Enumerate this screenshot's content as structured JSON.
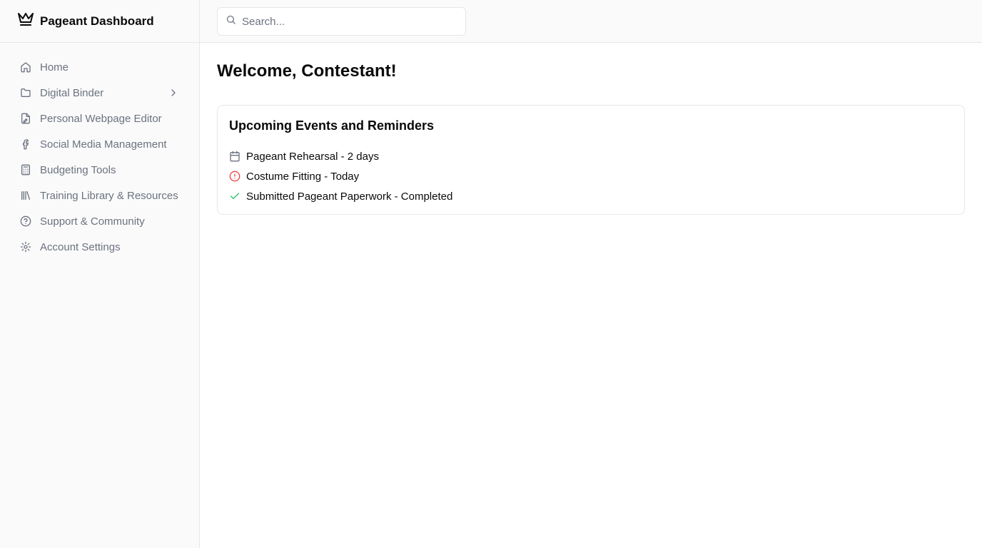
{
  "app": {
    "title": "Pageant Dashboard",
    "logo_icon": "crown-icon"
  },
  "sidebar": {
    "items": [
      {
        "label": "Home",
        "icon": "home-icon"
      },
      {
        "label": "Digital Binder",
        "icon": "folder-icon",
        "has_submenu": true
      },
      {
        "label": "Personal Webpage Editor",
        "icon": "file-edit-icon"
      },
      {
        "label": "Social Media Management",
        "icon": "facebook-icon"
      },
      {
        "label": "Budgeting Tools",
        "icon": "calculator-icon"
      },
      {
        "label": "Training Library & Resources",
        "icon": "library-icon"
      },
      {
        "label": "Support & Community",
        "icon": "help-circle-icon"
      },
      {
        "label": "Account Settings",
        "icon": "gear-icon"
      }
    ]
  },
  "search": {
    "placeholder": "Search...",
    "value": "",
    "icon": "search-icon"
  },
  "main": {
    "title": "Welcome, Contestant!",
    "card": {
      "title": "Upcoming Events and Reminders",
      "events": [
        {
          "text": "Pageant Rehearsal - 2 days",
          "icon": "calendar-icon",
          "color": "#6b7280"
        },
        {
          "text": "Costume Fitting - Today",
          "icon": "alert-circle-icon",
          "color": "#ef4444"
        },
        {
          "text": "Submitted Pageant Paperwork - Completed",
          "icon": "check-icon",
          "color": "#22c55e"
        }
      ]
    }
  },
  "colors": {
    "sidebar_bg": "#fafafa",
    "border": "#e5e7eb",
    "muted_text": "#6b7280",
    "alert": "#ef4444",
    "success": "#22c55e"
  }
}
